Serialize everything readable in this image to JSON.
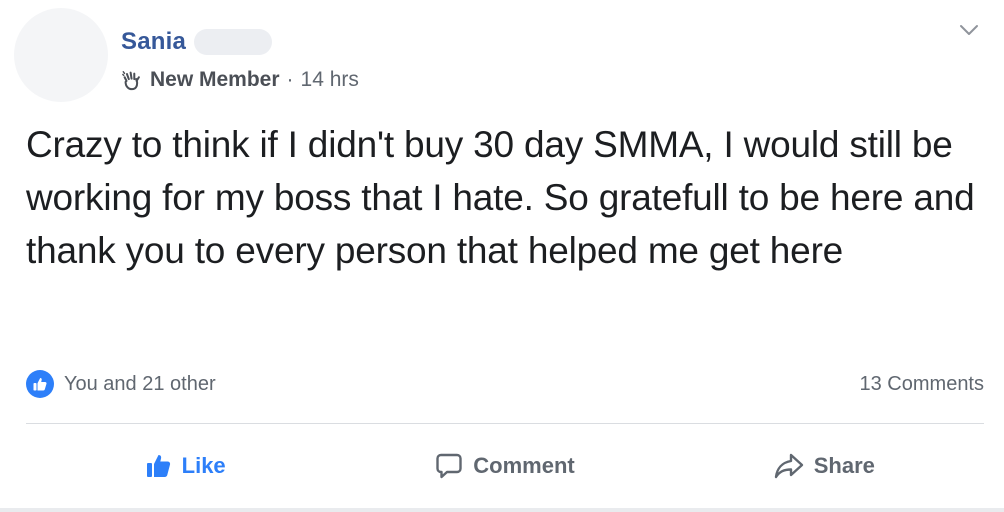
{
  "post": {
    "author_name": "Sania",
    "badge_label": "New Member",
    "separator": "·",
    "timestamp": "14 hrs",
    "body": "Crazy to think if I didn't buy 30 day SMMA, I would still be working for my boss that I hate. So gratefull to be here and thank you to every person that helped me get here",
    "reactions_text": "You and 21 other",
    "comments_count": "13 Comments"
  },
  "actions": {
    "like_label": "Like",
    "comment_label": "Comment",
    "share_label": "Share"
  },
  "icons": {
    "badge": "wave-hand-icon",
    "options": "chevron-down-icon",
    "reaction": "thumbs-up-icon",
    "like": "thumbs-up-icon",
    "comment": "speech-bubble-icon",
    "share": "share-arrow-icon"
  },
  "colors": {
    "name_link": "#365899",
    "like_blue": "#2d7ff9",
    "secondary_text": "#606770"
  }
}
